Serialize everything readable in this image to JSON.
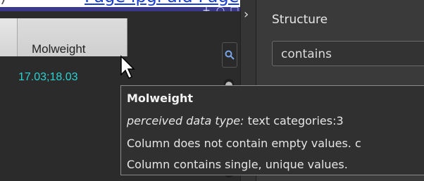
{
  "top_strip": {
    "fragment": ")",
    "link_text": "Page ipgl  ald Page"
  },
  "window": {
    "accent_color": "#3b3a8a"
  },
  "grid": {
    "column_header": "Molweight",
    "cell_value": "17.03;18.03",
    "cell_color": "#2ad3d3"
  },
  "right_panel": {
    "structure_label": "Structure",
    "filter_value": "contains"
  },
  "tooltip": {
    "title": "Molweight",
    "type_prefix": "perceived data type:",
    "type_rest": " text categories:3",
    "line_empty": "Column does not contain empty values. c",
    "line_unique": "Column contains single, unique values."
  },
  "icons": [
    "search-icon",
    "chevron-right-icon",
    "mouse-pointer-icon",
    "window-pin-icon",
    "window-search-icon",
    "window-restore-icon"
  ]
}
